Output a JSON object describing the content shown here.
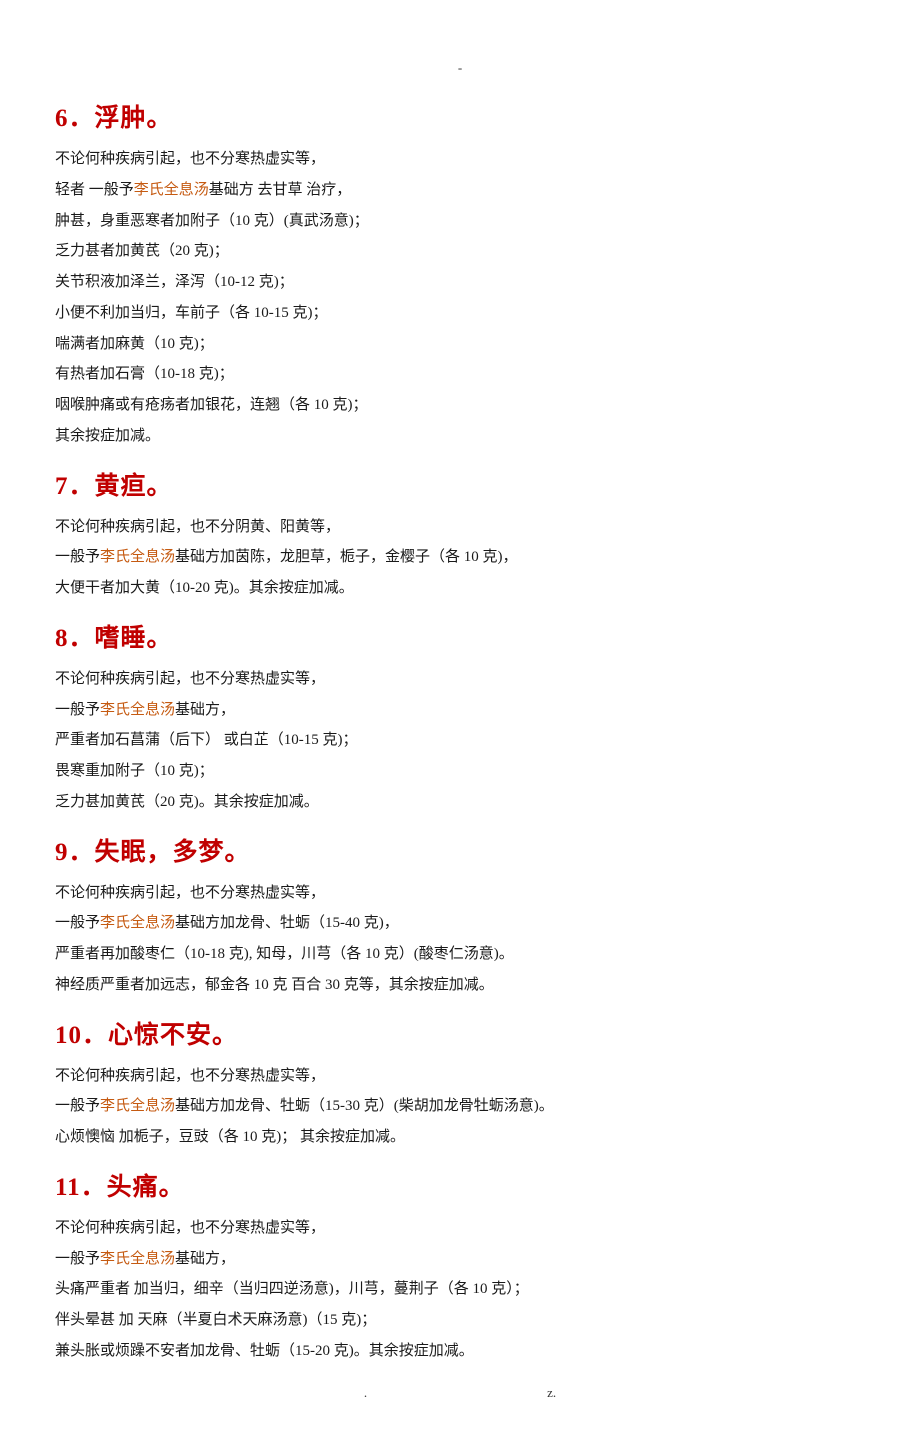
{
  "top_mark": "-",
  "footer_left": ".",
  "footer_right": "z.",
  "formula_name": "李氏全息汤",
  "sections": [
    {
      "num": "6",
      "title": "．浮肿。",
      "lines": [
        {
          "segs": [
            {
              "t": "不论何种疾病引起，也不分寒热虚实等，"
            }
          ]
        },
        {
          "segs": [
            {
              "t": "轻者 一般予"
            },
            {
              "t": "@F",
              "hl": true
            },
            {
              "t": "基础方 去甘草 治疗，"
            }
          ]
        },
        {
          "segs": [
            {
              "t": "肿甚，身重恶寒者加附子（10 克）(真武汤意)；"
            }
          ]
        },
        {
          "segs": [
            {
              "t": "乏力甚者加黄芪（20 克)；"
            }
          ]
        },
        {
          "segs": [
            {
              "t": "关节积液加泽兰，泽泻（10-12 克)；"
            }
          ]
        },
        {
          "segs": [
            {
              "t": "小便不利加当归，车前子（各 10-15 克)；"
            }
          ]
        },
        {
          "segs": [
            {
              "t": "喘满者加麻黄（10 克)；"
            }
          ]
        },
        {
          "segs": [
            {
              "t": "有热者加石膏（10-18 克)；"
            }
          ]
        },
        {
          "segs": [
            {
              "t": "咽喉肿痛或有疮疡者加银花，连翘（各 10 克)；"
            }
          ]
        },
        {
          "segs": [
            {
              "t": "其余按症加减。"
            }
          ]
        }
      ]
    },
    {
      "num": "7",
      "title": "．黄疸。",
      "lines": [
        {
          "segs": [
            {
              "t": "不论何种疾病引起，也不分阴黄、阳黄等，"
            }
          ]
        },
        {
          "segs": [
            {
              "t": "一般予"
            },
            {
              "t": "@F",
              "hl": true
            },
            {
              "t": "基础方加茵陈，龙胆草，栀子，金樱子（各 10 克)，"
            }
          ]
        },
        {
          "segs": [
            {
              "t": "大便干者加大黄（10-20 克)。其余按症加减。"
            }
          ]
        }
      ]
    },
    {
      "num": "8",
      "title": "．嗜睡。",
      "lines": [
        {
          "segs": [
            {
              "t": "不论何种疾病引起，也不分寒热虚实等，"
            }
          ]
        },
        {
          "segs": [
            {
              "t": "一般予"
            },
            {
              "t": "@F",
              "hl": true
            },
            {
              "t": "基础方，"
            }
          ]
        },
        {
          "segs": [
            {
              "t": "严重者加石菖蒲（后下） 或白芷（10-15 克)；"
            }
          ]
        },
        {
          "segs": [
            {
              "t": "畏寒重加附子（10 克)；"
            }
          ]
        },
        {
          "segs": [
            {
              "t": "乏力甚加黄芪（20 克)。其余按症加减。"
            }
          ]
        }
      ]
    },
    {
      "num": "9",
      "title": "．失眠，多梦。",
      "lines": [
        {
          "segs": [
            {
              "t": "不论何种疾病引起，也不分寒热虚实等，"
            }
          ]
        },
        {
          "segs": [
            {
              "t": "一般予"
            },
            {
              "t": "@F",
              "hl": true
            },
            {
              "t": "基础方加龙骨、牡蛎（15-40 克)，"
            }
          ]
        },
        {
          "segs": [
            {
              "t": "严重者再加酸枣仁（10-18 克), 知母，川芎（各 10 克）(酸枣仁汤意)。"
            }
          ]
        },
        {
          "segs": [
            {
              "t": "神经质严重者加远志，郁金各 10 克 百合 30 克等，其余按症加减。"
            }
          ]
        }
      ]
    },
    {
      "num": "10",
      "title": "．心惊不安。",
      "lines": [
        {
          "segs": [
            {
              "t": "不论何种疾病引起，也不分寒热虚实等，"
            }
          ]
        },
        {
          "segs": [
            {
              "t": "一般予"
            },
            {
              "t": "@F",
              "hl": true
            },
            {
              "t": "基础方加龙骨、牡蛎（15-30 克）(柴胡加龙骨牡蛎汤意)。"
            }
          ]
        },
        {
          "segs": [
            {
              "t": "心烦懊恼 加栀子，豆豉（各 10 克)；  其余按症加减。"
            }
          ]
        }
      ]
    },
    {
      "num": "11",
      "title": "．头痛。",
      "lines": [
        {
          "segs": [
            {
              "t": "不论何种疾病引起，也不分寒热虚实等，"
            }
          ]
        },
        {
          "segs": [
            {
              "t": "一般予"
            },
            {
              "t": "@F",
              "hl": true
            },
            {
              "t": "基础方，"
            }
          ]
        },
        {
          "segs": [
            {
              "t": "头痛严重者 加当归，细辛（当归四逆汤意)，川芎，蔓荆子（各 10 克）；"
            }
          ]
        },
        {
          "segs": [
            {
              "t": "伴头晕甚 加  天麻（半夏白术天麻汤意)（15 克)；"
            }
          ]
        },
        {
          "segs": [
            {
              "t": "兼头胀或烦躁不安者加龙骨、牡蛎（15-20 克)。其余按症加减。"
            }
          ]
        }
      ]
    }
  ]
}
